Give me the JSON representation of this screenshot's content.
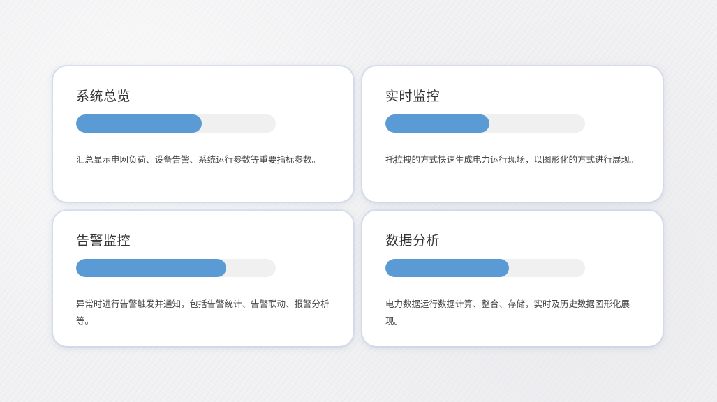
{
  "cards": [
    {
      "title": "系统总览",
      "progress": 0.63,
      "description": "汇总显示电网负荷、设备告警、系统运行参数等重要指标参数。"
    },
    {
      "title": "实时监控",
      "progress": 0.52,
      "description": "托拉拽的方式快速生成电力运行现场，以图形化的方式进行展现。"
    },
    {
      "title": "告警监控",
      "progress": 0.75,
      "description": "异常时进行告警触发并通知，包括告警统计、告警联动、报警分析等。"
    },
    {
      "title": "数据分析",
      "progress": 0.62,
      "description": "电力数据运行数据计算、整合、存储，实时及历史数据图形化展现。"
    }
  ],
  "colors": {
    "bar_fill": "#5b9bd5",
    "bar_track": "#f0f0f0",
    "card_bg": "#ffffff",
    "title_text": "#333333",
    "desc_text": "#444444"
  }
}
